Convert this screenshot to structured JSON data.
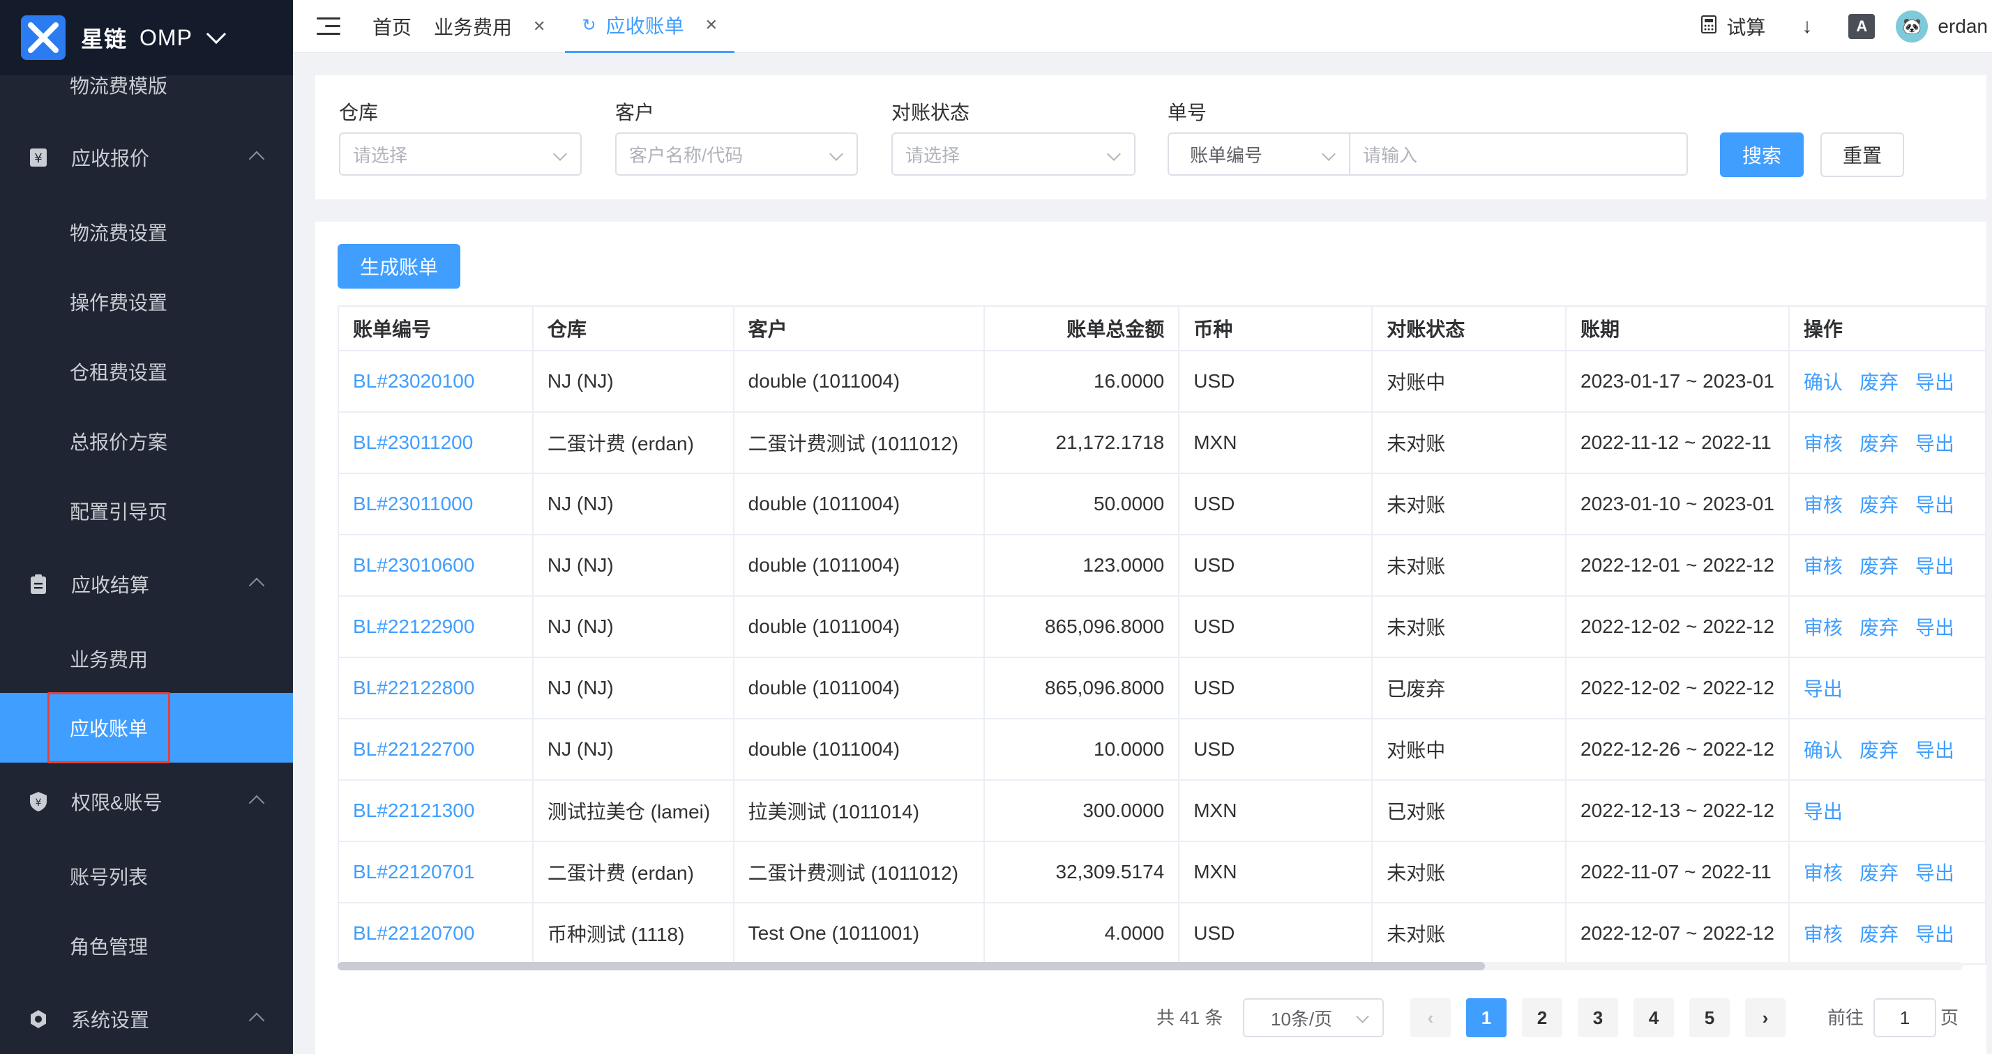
{
  "app": {
    "brand": "星链",
    "product": "OMP"
  },
  "sidebar": {
    "top_item": "物流费模版",
    "groups": [
      {
        "label": "应收报价",
        "icon": "yen-icon",
        "items": [
          "物流费设置",
          "操作费设置",
          "仓租费设置",
          "总报价方案",
          "配置引导页"
        ]
      },
      {
        "label": "应收结算",
        "icon": "clipboard-icon",
        "items": [
          "业务费用",
          "应收账单"
        ]
      },
      {
        "label": "权限&账号",
        "icon": "shield-icon",
        "items": [
          "账号列表",
          "角色管理"
        ]
      },
      {
        "label": "系统设置",
        "icon": "gear-icon",
        "items": []
      }
    ],
    "active_item": "应收账单"
  },
  "topbar": {
    "tabs": [
      {
        "label": "首页"
      },
      {
        "label": "业务费用"
      },
      {
        "label": "应收账单"
      }
    ],
    "calc_label": "试算",
    "user": "erdan",
    "lang_badge": "A"
  },
  "filter": {
    "warehouse_label": "仓库",
    "warehouse_placeholder": "请选择",
    "customer_label": "客户",
    "customer_placeholder": "客户名称/代码",
    "status_label": "对账状态",
    "status_placeholder": "请选择",
    "number_label": "单号",
    "number_type": "账单编号",
    "number_placeholder": "请输入",
    "search_label": "搜索",
    "reset_label": "重置"
  },
  "toolbar": {
    "generate_label": "生成账单"
  },
  "table": {
    "headers": [
      "账单编号",
      "仓库",
      "客户",
      "账单总金额",
      "币种",
      "对账状态",
      "账期",
      "操作"
    ],
    "rows": [
      {
        "no": "BL#23020100",
        "wh": "NJ (NJ)",
        "cust": "double (1011004)",
        "amt": "16.0000",
        "cur": "USD",
        "status": "对账中",
        "period": "2023-01-17 ~ 2023-01",
        "ops": [
          "确认",
          "废弃",
          "导出"
        ]
      },
      {
        "no": "BL#23011200",
        "wh": "二蛋计费 (erdan)",
        "cust": "二蛋计费测试 (1011012)",
        "amt": "21,172.1718",
        "cur": "MXN",
        "status": "未对账",
        "period": "2022-11-12 ~ 2022-11",
        "ops": [
          "审核",
          "废弃",
          "导出"
        ]
      },
      {
        "no": "BL#23011000",
        "wh": "NJ (NJ)",
        "cust": "double (1011004)",
        "amt": "50.0000",
        "cur": "USD",
        "status": "未对账",
        "period": "2023-01-10 ~ 2023-01",
        "ops": [
          "审核",
          "废弃",
          "导出"
        ]
      },
      {
        "no": "BL#23010600",
        "wh": "NJ (NJ)",
        "cust": "double (1011004)",
        "amt": "123.0000",
        "cur": "USD",
        "status": "未对账",
        "period": "2022-12-01 ~ 2022-12",
        "ops": [
          "审核",
          "废弃",
          "导出"
        ]
      },
      {
        "no": "BL#22122900",
        "wh": "NJ (NJ)",
        "cust": "double (1011004)",
        "amt": "865,096.8000",
        "cur": "USD",
        "status": "未对账",
        "period": "2022-12-02 ~ 2022-12",
        "ops": [
          "审核",
          "废弃",
          "导出"
        ]
      },
      {
        "no": "BL#22122800",
        "wh": "NJ (NJ)",
        "cust": "double (1011004)",
        "amt": "865,096.8000",
        "cur": "USD",
        "status": "已废弃",
        "period": "2022-12-02 ~ 2022-12",
        "ops": [
          "导出"
        ]
      },
      {
        "no": "BL#22122700",
        "wh": "NJ (NJ)",
        "cust": "double (1011004)",
        "amt": "10.0000",
        "cur": "USD",
        "status": "对账中",
        "period": "2022-12-26 ~ 2022-12",
        "ops": [
          "确认",
          "废弃",
          "导出"
        ]
      },
      {
        "no": "BL#22121300",
        "wh": "测试拉美仓 (lamei)",
        "cust": "拉美测试 (1011014)",
        "amt": "300.0000",
        "cur": "MXN",
        "status": "已对账",
        "period": "2022-12-13 ~ 2022-12",
        "ops": [
          "导出"
        ]
      },
      {
        "no": "BL#22120701",
        "wh": "二蛋计费 (erdan)",
        "cust": "二蛋计费测试 (1011012)",
        "amt": "32,309.5174",
        "cur": "MXN",
        "status": "未对账",
        "period": "2022-11-07 ~ 2022-11",
        "ops": [
          "审核",
          "废弃",
          "导出"
        ]
      },
      {
        "no": "BL#22120700",
        "wh": "币种测试 (1118)",
        "cust": "Test One (1011001)",
        "amt": "4.0000",
        "cur": "USD",
        "status": "未对账",
        "period": "2022-12-07 ~ 2022-12",
        "ops": [
          "审核",
          "废弃",
          "导出"
        ]
      }
    ]
  },
  "pagination": {
    "total": "共 41 条",
    "page_size": "10条/页",
    "pages": [
      "1",
      "2",
      "3",
      "4",
      "5"
    ],
    "current": "1",
    "goto_prefix": "前往",
    "goto_value": "1",
    "goto_suffix": "页"
  },
  "colors": {
    "accent": "#409eff",
    "sidebar_bg": "#1f2532",
    "highlight": "#e5413a"
  }
}
